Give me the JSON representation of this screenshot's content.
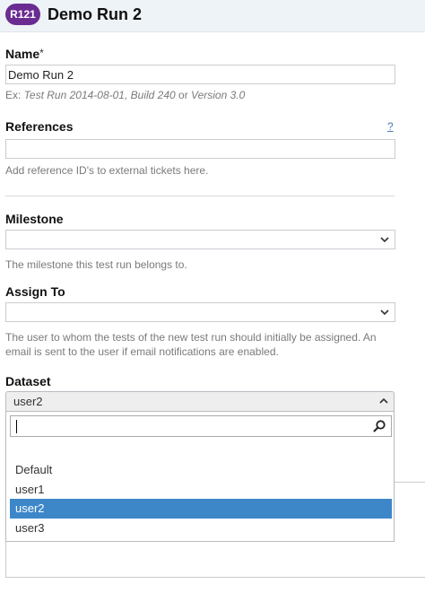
{
  "header": {
    "badge": "R121",
    "title": "Demo Run 2",
    "badge_color": "#6a2c91"
  },
  "form": {
    "name": {
      "label": "Name",
      "required_mark": "*",
      "value": "Demo Run 2",
      "help": "Ex: ",
      "help_example": "Test Run 2014-08-01, Build 240",
      "help_or": " or ",
      "help_example2": "Version 3.0"
    },
    "references": {
      "label": "References",
      "help_link": "?",
      "value": "",
      "help": "Add reference ID's to external tickets here."
    },
    "milestone": {
      "label": "Milestone",
      "value": "",
      "help": "The milestone this test run belongs to."
    },
    "assign_to": {
      "label": "Assign To",
      "value": "",
      "help_line1": "The user to whom the tests of the new test run should initially be assigned. An",
      "help_line2": "email is sent to the user if email notifications are enabled."
    },
    "dataset": {
      "label": "Dataset",
      "value": "user2",
      "search_value": "",
      "options": [
        "Default",
        "user1",
        "user2",
        "user3"
      ],
      "selected_index": 2,
      "highlight_color": "#3d87c9"
    }
  }
}
